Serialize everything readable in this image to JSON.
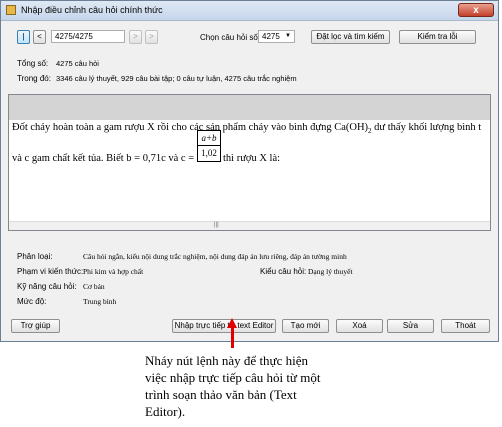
{
  "window": {
    "title": "Nhập điều chỉnh câu hỏi chính thức",
    "close_label": "x"
  },
  "toolbar": {
    "first_label": "|",
    "prev_label": "<",
    "position_value": "4275/4275",
    "next_label": ">",
    "last_label": ">",
    "select_label": "Chọn câu hỏi số:",
    "select_value": "4275",
    "filter_label": "Đặt lọc và tìm kiếm",
    "check_label": "Kiểm tra lỗi"
  },
  "summary": {
    "total_label": "Tổng số:",
    "total_value": "4275 câu hỏi",
    "detail_label": "Trong đó:",
    "detail_value": "3346 câu lý thuyết, 929 câu bài tập; 0 câu tự luận, 4275 câu trắc nghiệm"
  },
  "editor": {
    "line1_a": "Đốt cháy hoàn toàn a gam rượu X rồi cho các sản phẩm cháy vào bình đựng Ca(OH)",
    "line1_sub": "2",
    "line1_b": " dư thấy khối lượng bình t",
    "line2_a": "và c gam chất kết tủa. Biết b = 0,71c và c =",
    "frac_num": "a+b",
    "frac_den": "1,02",
    "line2_b": " thì rượu X là:",
    "scroll_dots": "|||"
  },
  "props": {
    "type_label": "Phân loại:",
    "type_value": "Câu hỏi ngắn, kiểu nội dung trắc nghiệm, nội dung đáp án lưu riêng, đáp án tường minh",
    "scope_label": "Phạm vi kiến thức:",
    "scope_value": "Phi kim và hợp chất",
    "qtype_label": "Kiểu câu hỏi:",
    "qtype_value": "Dạng lý thuyết",
    "skill_label": "Kỹ năng câu hỏi:",
    "skill_value": "Cơ bản",
    "level_label": "Mức độ:",
    "level_value": "Trung bình"
  },
  "buttons": {
    "help": "Trợ giúp",
    "direct_input": "Nhập trực tiếp từ text Editor",
    "new": "Tạo mới",
    "delete": "Xoá",
    "edit": "Sửa",
    "exit": "Thoát"
  },
  "caption": {
    "line1": "Nháy nút lệnh này để thực hiện",
    "line2": "việc nhập trực tiếp câu hỏi từ một",
    "line3": "trình soạn thảo văn bản (Text",
    "line4": "Editor)."
  },
  "colors": {
    "arrow": "#e00000",
    "title_gradient_top": "#dfe9f5",
    "close_red": "#c2402a"
  }
}
